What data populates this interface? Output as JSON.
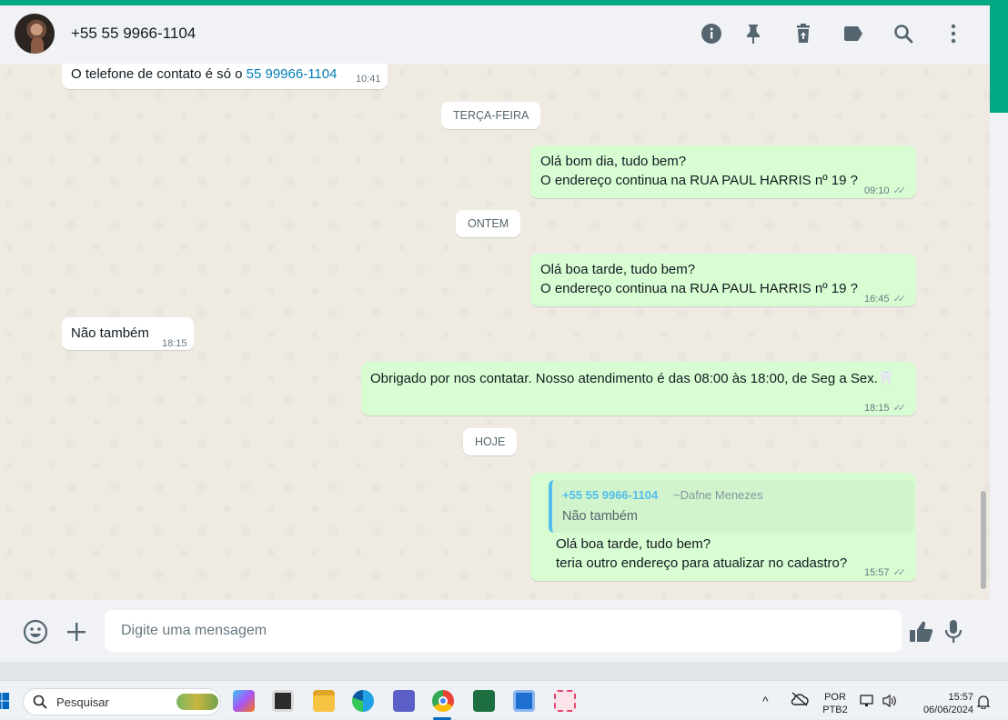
{
  "header": {
    "contact_name": "+55 55 9966-1104",
    "icons": [
      "info-icon",
      "pin-icon",
      "delete-icon",
      "label-icon",
      "search-icon",
      "menu-icon"
    ]
  },
  "messages": [
    {
      "dir": "in",
      "text_prefix": "O telefone de contato é só o ",
      "link": "55 99966-1104",
      "time": "10:41"
    },
    {
      "dir": "day",
      "text": "TERÇA-FEIRA"
    },
    {
      "dir": "out",
      "lines": [
        "Olá bom dia, tudo bem?",
        "O endereço continua na RUA PAUL HARRIS nº 19 ?"
      ],
      "time": "09:10"
    },
    {
      "dir": "day",
      "text": "ONTEM"
    },
    {
      "dir": "out",
      "lines": [
        "Olá boa tarde, tudo bem?",
        "O endereço continua na RUA PAUL HARRIS nº 19 ?"
      ],
      "time": "16:45"
    },
    {
      "dir": "in",
      "text": "Não também",
      "time": "18:15"
    },
    {
      "dir": "out",
      "text": "Obrigado por nos contatar. Nosso atendimento é das 08:00 às 18:00, de Seg a Sex.🦷",
      "time": "18:15"
    },
    {
      "dir": "day",
      "text": "HOJE"
    },
    {
      "dir": "out",
      "quote": {
        "sender": "+55 55 9966-1104",
        "alias": "~Dafne Menezes",
        "text": "Não também"
      },
      "lines": [
        "Olá boa tarde, tudo bem?",
        "teria outro endereço para atualizar no cadastro?"
      ],
      "time": "15:57"
    }
  ],
  "composer": {
    "placeholder": "Digite uma mensagem"
  },
  "taskbar": {
    "search_label": "Pesquisar",
    "lang_top": "POR",
    "lang_bottom": "PTB2",
    "clock_time": "15:57",
    "clock_date": "06/06/2024"
  },
  "colors": {
    "accent": "#00a884",
    "outgoing_bubble": "#d9fdd3",
    "incoming_bubble": "#ffffff",
    "chat_background": "#efeae2",
    "link": "#027eb5",
    "quote_sender": "#53bdeb"
  }
}
